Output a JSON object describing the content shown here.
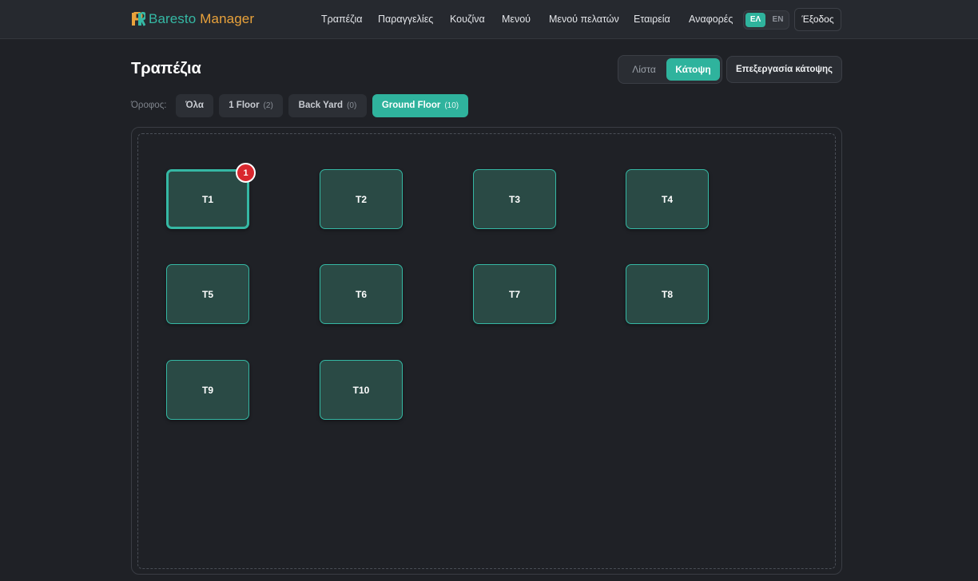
{
  "brand": {
    "name": "Baresto",
    "sub": "Manager",
    "colors": {
      "primary": "#35b8a4",
      "accent": "#e9a23b"
    }
  },
  "nav": {
    "items": [
      "Τραπέζια",
      "Παραγγελίες",
      "Κουζίνα",
      "Μενού",
      "Μενού πελατών",
      "Εταιρεία",
      "Αναφορές"
    ],
    "lang": {
      "el": "ΕΛ",
      "en": "EN",
      "active": "ΕΛ"
    },
    "logout": "Έξοδος"
  },
  "page": {
    "title": "Τραπέζια",
    "view_toggle": {
      "list": "Λίστα",
      "plan": "Κάτοψη",
      "active": "Κάτοψη"
    },
    "edit_plan": "Επεξεργασία κάτοψης"
  },
  "floors": {
    "label": "Όροφος:",
    "options": [
      {
        "name": "Όλα",
        "count": ""
      },
      {
        "name": "1 Floor",
        "count": "(2)"
      },
      {
        "name": "Back Yard",
        "count": "(0)"
      },
      {
        "name": "Ground Floor",
        "count": "(10)"
      }
    ],
    "active": "Ground Floor"
  },
  "tables": [
    {
      "label": "T1",
      "badge": "1",
      "selected": true
    },
    {
      "label": "T2",
      "badge": ""
    },
    {
      "label": "T3",
      "badge": ""
    },
    {
      "label": "T4",
      "badge": ""
    },
    {
      "label": "T5",
      "badge": ""
    },
    {
      "label": "T6",
      "badge": ""
    },
    {
      "label": "T7",
      "badge": ""
    },
    {
      "label": "T8",
      "badge": ""
    },
    {
      "label": "T9",
      "badge": ""
    },
    {
      "label": "T10",
      "badge": ""
    }
  ]
}
